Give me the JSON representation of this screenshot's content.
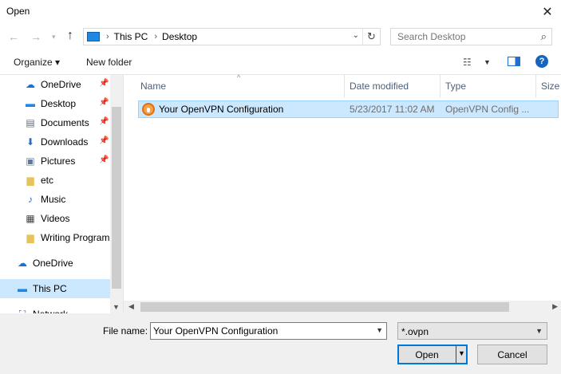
{
  "window": {
    "title": "Open",
    "close_glyph": "✕"
  },
  "navigation": {
    "back_glyph": "←",
    "forward_glyph": "→",
    "recent_glyph": "▾",
    "up_glyph": "↑",
    "breadcrumbs": [
      "This PC",
      "Desktop"
    ],
    "separator": "›",
    "refresh_glyph": "↻"
  },
  "search": {
    "placeholder": "Search Desktop",
    "icon": "search-icon"
  },
  "toolbar": {
    "organize_label": "Organize ▾",
    "new_folder_label": "New folder",
    "view_glyph": "☷",
    "help_glyph": "?"
  },
  "sidebar": {
    "items": [
      {
        "label": "OneDrive",
        "icon": "onedrive-icon",
        "glyph": "☁",
        "color": "#1e6fd0",
        "pinned": true
      },
      {
        "label": "Desktop",
        "icon": "desktop-icon",
        "glyph": "▬",
        "color": "#1e88e5",
        "pinned": true
      },
      {
        "label": "Documents",
        "icon": "documents-icon",
        "glyph": "▤",
        "color": "#5f6b7a",
        "pinned": true
      },
      {
        "label": "Downloads",
        "icon": "downloads-icon",
        "glyph": "⬇",
        "color": "#1e6fd0",
        "pinned": true
      },
      {
        "label": "Pictures",
        "icon": "pictures-icon",
        "glyph": "▣",
        "color": "#5f7a9a",
        "pinned": true
      },
      {
        "label": "etc",
        "icon": "folder-icon",
        "glyph": "▆",
        "color": "#e8c25a",
        "pinned": false
      },
      {
        "label": "Music",
        "icon": "music-icon",
        "glyph": "♪",
        "color": "#1e6fd0",
        "pinned": false
      },
      {
        "label": "Videos",
        "icon": "videos-icon",
        "glyph": "▦",
        "color": "#444444",
        "pinned": false
      },
      {
        "label": "Writing Program",
        "icon": "folder-icon",
        "glyph": "▆",
        "color": "#e8c25a",
        "pinned": false
      },
      {
        "label": "OneDrive",
        "icon": "onedrive-icon",
        "glyph": "☁",
        "color": "#1e6fd0",
        "pinned": false
      },
      {
        "label": "This PC",
        "icon": "this-pc-icon",
        "glyph": "▬",
        "color": "#1e88e5",
        "pinned": false,
        "selected": true
      },
      {
        "label": "Network",
        "icon": "network-icon",
        "glyph": "⛶",
        "color": "#1e6fd0",
        "pinned": false
      }
    ],
    "pin_glyph": "📌"
  },
  "file_list": {
    "columns": [
      "Name",
      "Date modified",
      "Type",
      "Size"
    ],
    "sort_glyph": "^",
    "rows": [
      {
        "name": "Your OpenVPN Configuration",
        "date_modified": "5/23/2017 11:02 AM",
        "type": "OpenVPN Config ...",
        "size": "",
        "icon": "openvpn-icon",
        "selected": true
      }
    ]
  },
  "footer": {
    "file_name_label": "File name:",
    "file_name_value": "Your OpenVPN Configuration",
    "filter_value": "*.ovpn",
    "open_label": "Open",
    "cancel_label": "Cancel"
  },
  "colors": {
    "selection": "#cce8ff",
    "accent": "#0078d7"
  }
}
